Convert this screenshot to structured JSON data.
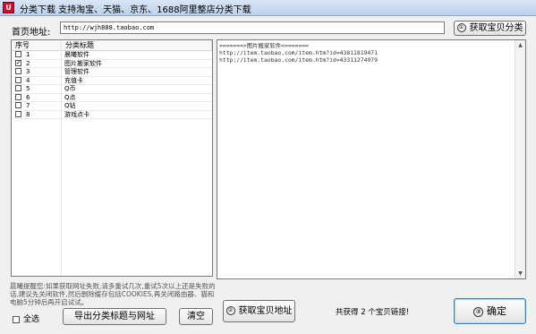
{
  "window": {
    "title": "分类下载    支持淘宝、天猫、京东、1688阿里整店分类下载",
    "icon": "app-icon"
  },
  "url_field": {
    "label": "首页地址:",
    "value": "http://wjh888.taobao.com"
  },
  "buttons": {
    "get_categories": "获取宝贝分类",
    "export": "导出分类标题与网址",
    "clear": "清空",
    "get_links": "获取宝贝地址",
    "ok": "确定"
  },
  "list": {
    "headers": [
      "序号",
      "分类标题"
    ],
    "rows": [
      {
        "num": "1",
        "title": "晨曦软件",
        "checked": false
      },
      {
        "num": "2",
        "title": "图片搬家软件",
        "checked": true
      },
      {
        "num": "3",
        "title": "管理软件",
        "checked": false
      },
      {
        "num": "4",
        "title": "充值卡",
        "checked": false
      },
      {
        "num": "5",
        "title": "Q币",
        "checked": false
      },
      {
        "num": "6",
        "title": "Q点",
        "checked": false
      },
      {
        "num": "7",
        "title": "Q钻",
        "checked": false
      },
      {
        "num": "8",
        "title": "游戏点卡",
        "checked": false
      }
    ]
  },
  "output": {
    "lines": [
      "=======>图片搬家软件<=======",
      "http://item.taobao.com/item.htm?id=43811819471",
      "http://item.taobao.com/item.htm?id=43311274979"
    ]
  },
  "tip": "晨曦提醒您:如果获取网址失败,请多重试几次,重试5次以上还是失败的话,建议先关闭软件,然后删除缓存包括COOKIES,再关闭路由器、猫和电脑5分钟后再开启试试。",
  "select_all": "全选",
  "status": "共获得 2 个宝贝链接!"
}
